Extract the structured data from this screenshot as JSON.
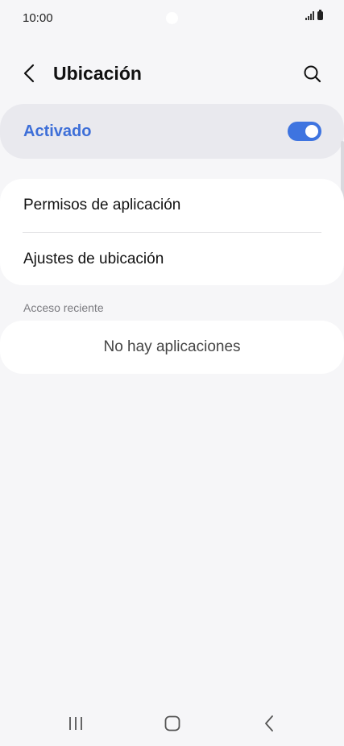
{
  "status_bar": {
    "time": "10:00"
  },
  "header": {
    "title": "Ubicación",
    "back_icon": "chevron-left-icon",
    "search_icon": "search-icon"
  },
  "master_switch": {
    "label": "Activado",
    "enabled": true,
    "accent_color": "#3e74e0"
  },
  "options": [
    {
      "label": "Permisos de aplicación"
    },
    {
      "label": "Ajustes de ubicación"
    }
  ],
  "recent_access": {
    "header": "Acceso reciente",
    "empty_text": "No hay aplicaciones"
  },
  "nav_bar": {
    "recent_icon": "recent-apps-icon",
    "home_icon": "home-icon",
    "back_icon": "back-icon"
  }
}
